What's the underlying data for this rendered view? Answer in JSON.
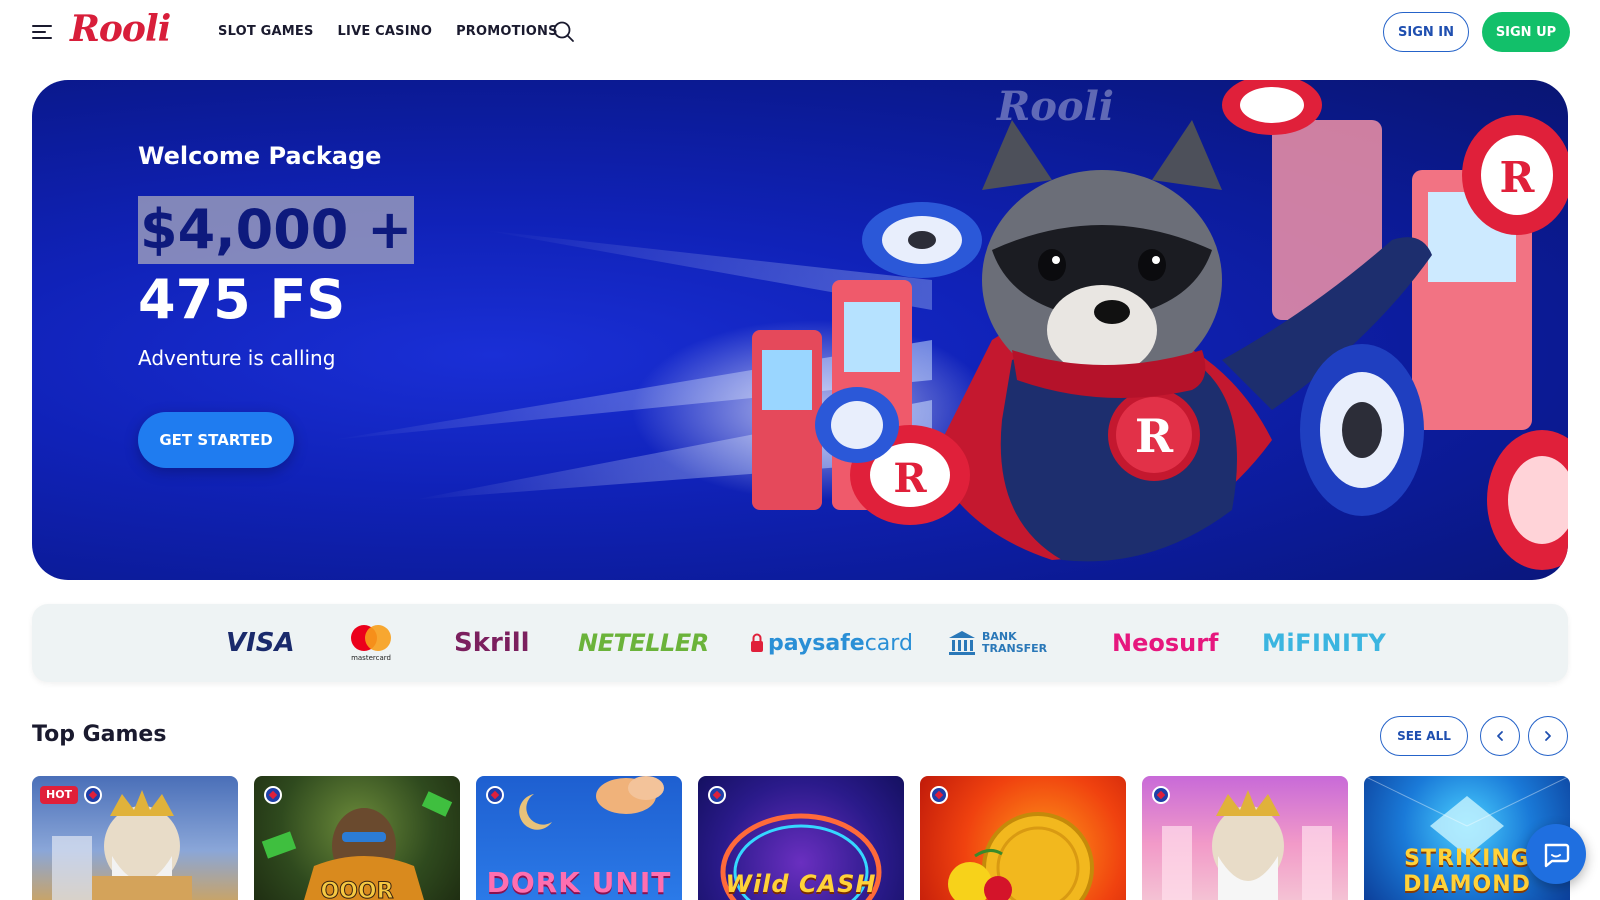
{
  "header": {
    "logo": "Rooli",
    "nav": [
      "SLOT GAMES",
      "LIVE CASINO",
      "PROMOTIONS"
    ],
    "signin_label": "SIGN IN",
    "signup_label": "SIGN UP"
  },
  "hero": {
    "title": "Welcome Package",
    "amount": "$4,000 +",
    "free_spins": "475 FS",
    "subtitle": "Adventure is calling",
    "cta_label": "GET STARTED"
  },
  "payments": {
    "visa": "VISA",
    "mastercard": "mastercard",
    "skrill": "Skrill",
    "neteller": "NETELLER",
    "paysafe_a": "paysafe",
    "paysafe_b": "card",
    "bank_line1": "BANK",
    "bank_line2": "TRANSFER",
    "neosurf": "Neosurf",
    "mifinity": "MiFINITY"
  },
  "top_games": {
    "title": "Top Games",
    "see_all_label": "SEE ALL",
    "hot_badge": "HOT",
    "games": [
      {
        "title": ""
      },
      {
        "title": ""
      },
      {
        "title": "DORK UNIT"
      },
      {
        "title": "Wild CASH"
      },
      {
        "title": ""
      },
      {
        "title": ""
      },
      {
        "title": "STRIKING DIAMOND"
      }
    ]
  },
  "colors": {
    "brand_red": "#d81e3a",
    "signup_green": "#12c06a",
    "cta_blue": "#1f7cf0",
    "hero_blue": "#1022b8"
  }
}
